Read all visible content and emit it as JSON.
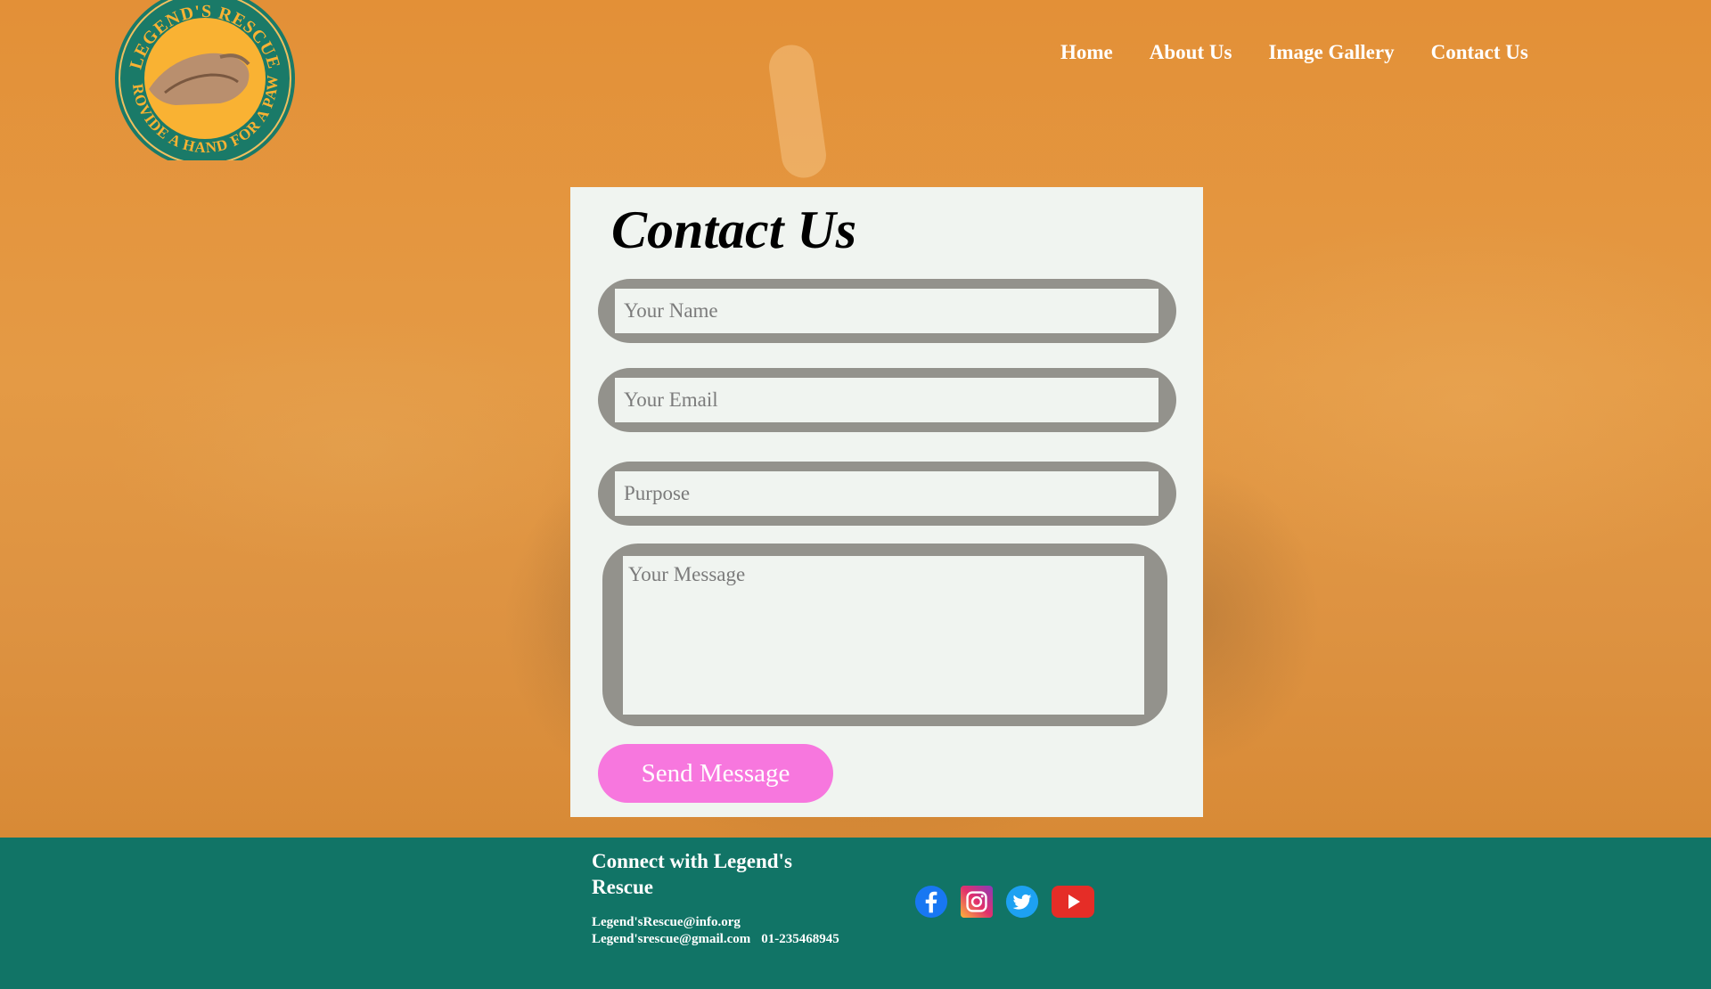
{
  "logo": {
    "top_text": "LEGEND'S RESCUE",
    "bottom_text": "PROVIDE A HAND FOR A PAW"
  },
  "nav": {
    "items": [
      {
        "label": "Home"
      },
      {
        "label": "About Us"
      },
      {
        "label": "Image Gallery"
      },
      {
        "label": "Contact Us"
      }
    ]
  },
  "contact": {
    "title": "Contact Us",
    "name_placeholder": "Your Name",
    "email_placeholder": "Your Email",
    "purpose_placeholder": "Purpose",
    "message_placeholder": "Your Message",
    "send_label": "Send Message"
  },
  "footer": {
    "connect_title": "Connect with Legend's Rescue",
    "email_1": "Legend'sRescue@info.org",
    "email_2": "Legend'srescue@gmail.com",
    "phone": "01-235468945",
    "social": [
      "facebook-icon",
      "instagram-icon",
      "twitter-icon",
      "youtube-icon"
    ]
  },
  "colors": {
    "background": "#e08f33",
    "card": "#f0f4f0",
    "field_border": "#93928c",
    "button": "#f777de",
    "footer": "#117466",
    "logo_ring": "#1a7a68",
    "logo_center": "#f9b233"
  }
}
